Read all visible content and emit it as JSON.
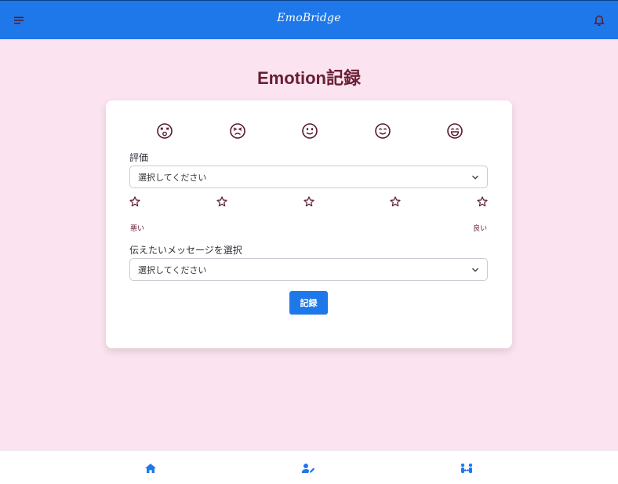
{
  "header": {
    "brand": "EmoBridge",
    "menu_icon": "menu-icon",
    "bell_icon": "bell-icon"
  },
  "page": {
    "title": "Emotion記録"
  },
  "form": {
    "faces": [
      "dizzy-face-icon",
      "angry-face-icon",
      "neutral-face-icon",
      "smile-face-icon",
      "laugh-face-icon"
    ],
    "rating_label": "評価",
    "rating_select_value": "選択してください",
    "stars": [
      "star-icon",
      "star-icon",
      "star-icon",
      "star-icon",
      "star-icon"
    ],
    "scale_bad": "悪い",
    "scale_good": "良い",
    "message_label": "伝えたいメッセージを選択",
    "message_select_value": "選択してください",
    "submit_label": "記録"
  },
  "bottom_nav": {
    "items": [
      "home-icon",
      "user-edit-icon",
      "people-arrows-icon"
    ]
  },
  "colors": {
    "header_bg": "#1f78ea",
    "page_bg": "#fbe3ef",
    "title": "#6a1d33",
    "accent": "#1f78ea",
    "icon_dark": "#5a1a2e"
  }
}
